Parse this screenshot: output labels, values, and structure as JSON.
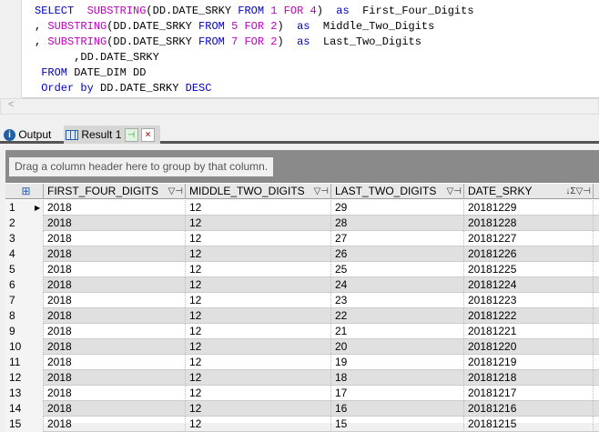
{
  "editor": {
    "lines": [
      [
        [
          "kw",
          "SELECT  "
        ],
        [
          "fn",
          "SUBSTRING"
        ],
        [
          "",
          "(DD.DATE_SRKY "
        ],
        [
          "kw",
          "FROM "
        ],
        [
          "num",
          "1 "
        ],
        [
          "fn",
          "FOR "
        ],
        [
          "num",
          "4"
        ],
        [
          "",
          ")  "
        ],
        [
          "kw",
          "as"
        ],
        [
          "",
          "  First_Four_Digits"
        ]
      ],
      [
        [
          "",
          ", "
        ],
        [
          "fn",
          "SUBSTRING"
        ],
        [
          "",
          "(DD.DATE_SRKY "
        ],
        [
          "kw",
          "FROM "
        ],
        [
          "num",
          "5 "
        ],
        [
          "fn",
          "FOR "
        ],
        [
          "num",
          "2"
        ],
        [
          "",
          ")  "
        ],
        [
          "kw",
          "as"
        ],
        [
          "",
          "  Middle_Two_Digits"
        ]
      ],
      [
        [
          "",
          ", "
        ],
        [
          "fn",
          "SUBSTRING"
        ],
        [
          "",
          "(DD.DATE_SRKY "
        ],
        [
          "kw",
          "FROM "
        ],
        [
          "num",
          "7 "
        ],
        [
          "fn",
          "FOR "
        ],
        [
          "num",
          "2"
        ],
        [
          "",
          ")  "
        ],
        [
          "kw",
          "as"
        ],
        [
          "",
          "  Last_Two_Digits"
        ]
      ],
      [
        [
          "",
          "      ,DD.DATE_SRKY"
        ]
      ],
      [
        [
          "kw",
          " FROM "
        ],
        [
          "",
          "DATE_DIM DD"
        ]
      ],
      [
        [
          "kw",
          " Order by "
        ],
        [
          "",
          "DD.DATE_SRKY "
        ],
        [
          "kw",
          "DESC"
        ]
      ]
    ]
  },
  "scroll_left": "<",
  "tabs": {
    "output": "Output",
    "result": "Result 1"
  },
  "grid": {
    "group_hint": "Drag a column header here to group by that column.",
    "columns": [
      "FIRST_FOUR_DIGITS",
      "MIDDLE_TWO_DIGITS",
      "LAST_TWO_DIGITS",
      "DATE_SRKY"
    ],
    "rows": [
      [
        "1",
        "2018",
        "12",
        "29",
        "20181229"
      ],
      [
        "2",
        "2018",
        "12",
        "28",
        "20181228"
      ],
      [
        "3",
        "2018",
        "12",
        "27",
        "20181227"
      ],
      [
        "4",
        "2018",
        "12",
        "26",
        "20181226"
      ],
      [
        "5",
        "2018",
        "12",
        "25",
        "20181225"
      ],
      [
        "6",
        "2018",
        "12",
        "24",
        "20181224"
      ],
      [
        "7",
        "2018",
        "12",
        "23",
        "20181223"
      ],
      [
        "8",
        "2018",
        "12",
        "22",
        "20181222"
      ],
      [
        "9",
        "2018",
        "12",
        "21",
        "20181221"
      ],
      [
        "10",
        "2018",
        "12",
        "20",
        "20181220"
      ],
      [
        "11",
        "2018",
        "12",
        "19",
        "20181219"
      ],
      [
        "12",
        "2018",
        "12",
        "18",
        "20181218"
      ],
      [
        "13",
        "2018",
        "12",
        "17",
        "20181217"
      ],
      [
        "14",
        "2018",
        "12",
        "16",
        "20181216"
      ],
      [
        "15",
        "2018",
        "12",
        "15",
        "20181215"
      ]
    ],
    "current_row": "1",
    "sort": "DATE_SRKY descending"
  }
}
